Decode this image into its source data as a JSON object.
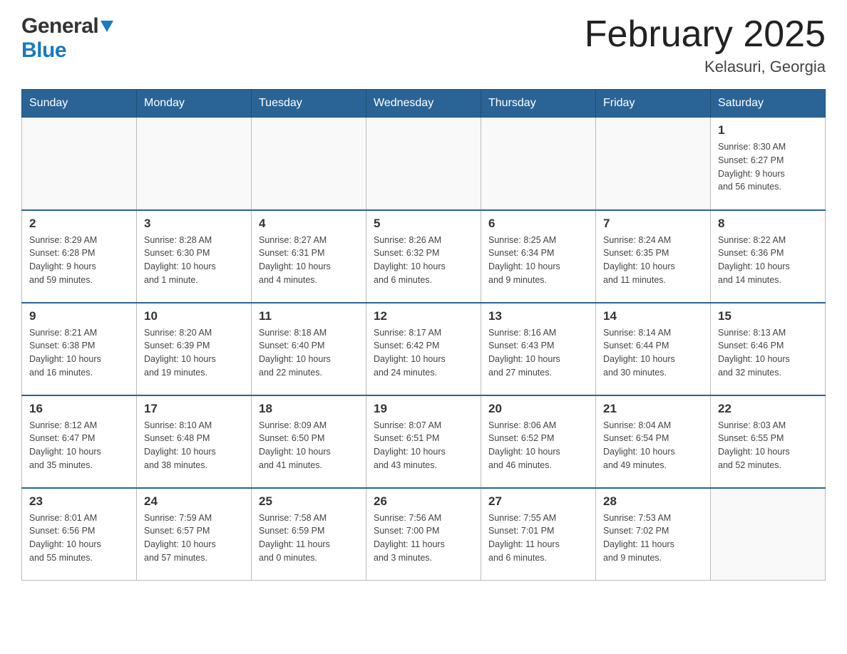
{
  "logo": {
    "general": "General",
    "triangle": "▼",
    "blue": "Blue"
  },
  "header": {
    "month_year": "February 2025",
    "location": "Kelasuri, Georgia"
  },
  "days_of_week": [
    "Sunday",
    "Monday",
    "Tuesday",
    "Wednesday",
    "Thursday",
    "Friday",
    "Saturday"
  ],
  "weeks": [
    [
      {
        "day": "",
        "info": ""
      },
      {
        "day": "",
        "info": ""
      },
      {
        "day": "",
        "info": ""
      },
      {
        "day": "",
        "info": ""
      },
      {
        "day": "",
        "info": ""
      },
      {
        "day": "",
        "info": ""
      },
      {
        "day": "1",
        "info": "Sunrise: 8:30 AM\nSunset: 6:27 PM\nDaylight: 9 hours\nand 56 minutes."
      }
    ],
    [
      {
        "day": "2",
        "info": "Sunrise: 8:29 AM\nSunset: 6:28 PM\nDaylight: 9 hours\nand 59 minutes."
      },
      {
        "day": "3",
        "info": "Sunrise: 8:28 AM\nSunset: 6:30 PM\nDaylight: 10 hours\nand 1 minute."
      },
      {
        "day": "4",
        "info": "Sunrise: 8:27 AM\nSunset: 6:31 PM\nDaylight: 10 hours\nand 4 minutes."
      },
      {
        "day": "5",
        "info": "Sunrise: 8:26 AM\nSunset: 6:32 PM\nDaylight: 10 hours\nand 6 minutes."
      },
      {
        "day": "6",
        "info": "Sunrise: 8:25 AM\nSunset: 6:34 PM\nDaylight: 10 hours\nand 9 minutes."
      },
      {
        "day": "7",
        "info": "Sunrise: 8:24 AM\nSunset: 6:35 PM\nDaylight: 10 hours\nand 11 minutes."
      },
      {
        "day": "8",
        "info": "Sunrise: 8:22 AM\nSunset: 6:36 PM\nDaylight: 10 hours\nand 14 minutes."
      }
    ],
    [
      {
        "day": "9",
        "info": "Sunrise: 8:21 AM\nSunset: 6:38 PM\nDaylight: 10 hours\nand 16 minutes."
      },
      {
        "day": "10",
        "info": "Sunrise: 8:20 AM\nSunset: 6:39 PM\nDaylight: 10 hours\nand 19 minutes."
      },
      {
        "day": "11",
        "info": "Sunrise: 8:18 AM\nSunset: 6:40 PM\nDaylight: 10 hours\nand 22 minutes."
      },
      {
        "day": "12",
        "info": "Sunrise: 8:17 AM\nSunset: 6:42 PM\nDaylight: 10 hours\nand 24 minutes."
      },
      {
        "day": "13",
        "info": "Sunrise: 8:16 AM\nSunset: 6:43 PM\nDaylight: 10 hours\nand 27 minutes."
      },
      {
        "day": "14",
        "info": "Sunrise: 8:14 AM\nSunset: 6:44 PM\nDaylight: 10 hours\nand 30 minutes."
      },
      {
        "day": "15",
        "info": "Sunrise: 8:13 AM\nSunset: 6:46 PM\nDaylight: 10 hours\nand 32 minutes."
      }
    ],
    [
      {
        "day": "16",
        "info": "Sunrise: 8:12 AM\nSunset: 6:47 PM\nDaylight: 10 hours\nand 35 minutes."
      },
      {
        "day": "17",
        "info": "Sunrise: 8:10 AM\nSunset: 6:48 PM\nDaylight: 10 hours\nand 38 minutes."
      },
      {
        "day": "18",
        "info": "Sunrise: 8:09 AM\nSunset: 6:50 PM\nDaylight: 10 hours\nand 41 minutes."
      },
      {
        "day": "19",
        "info": "Sunrise: 8:07 AM\nSunset: 6:51 PM\nDaylight: 10 hours\nand 43 minutes."
      },
      {
        "day": "20",
        "info": "Sunrise: 8:06 AM\nSunset: 6:52 PM\nDaylight: 10 hours\nand 46 minutes."
      },
      {
        "day": "21",
        "info": "Sunrise: 8:04 AM\nSunset: 6:54 PM\nDaylight: 10 hours\nand 49 minutes."
      },
      {
        "day": "22",
        "info": "Sunrise: 8:03 AM\nSunset: 6:55 PM\nDaylight: 10 hours\nand 52 minutes."
      }
    ],
    [
      {
        "day": "23",
        "info": "Sunrise: 8:01 AM\nSunset: 6:56 PM\nDaylight: 10 hours\nand 55 minutes."
      },
      {
        "day": "24",
        "info": "Sunrise: 7:59 AM\nSunset: 6:57 PM\nDaylight: 10 hours\nand 57 minutes."
      },
      {
        "day": "25",
        "info": "Sunrise: 7:58 AM\nSunset: 6:59 PM\nDaylight: 11 hours\nand 0 minutes."
      },
      {
        "day": "26",
        "info": "Sunrise: 7:56 AM\nSunset: 7:00 PM\nDaylight: 11 hours\nand 3 minutes."
      },
      {
        "day": "27",
        "info": "Sunrise: 7:55 AM\nSunset: 7:01 PM\nDaylight: 11 hours\nand 6 minutes."
      },
      {
        "day": "28",
        "info": "Sunrise: 7:53 AM\nSunset: 7:02 PM\nDaylight: 11 hours\nand 9 minutes."
      },
      {
        "day": "",
        "info": ""
      }
    ]
  ]
}
